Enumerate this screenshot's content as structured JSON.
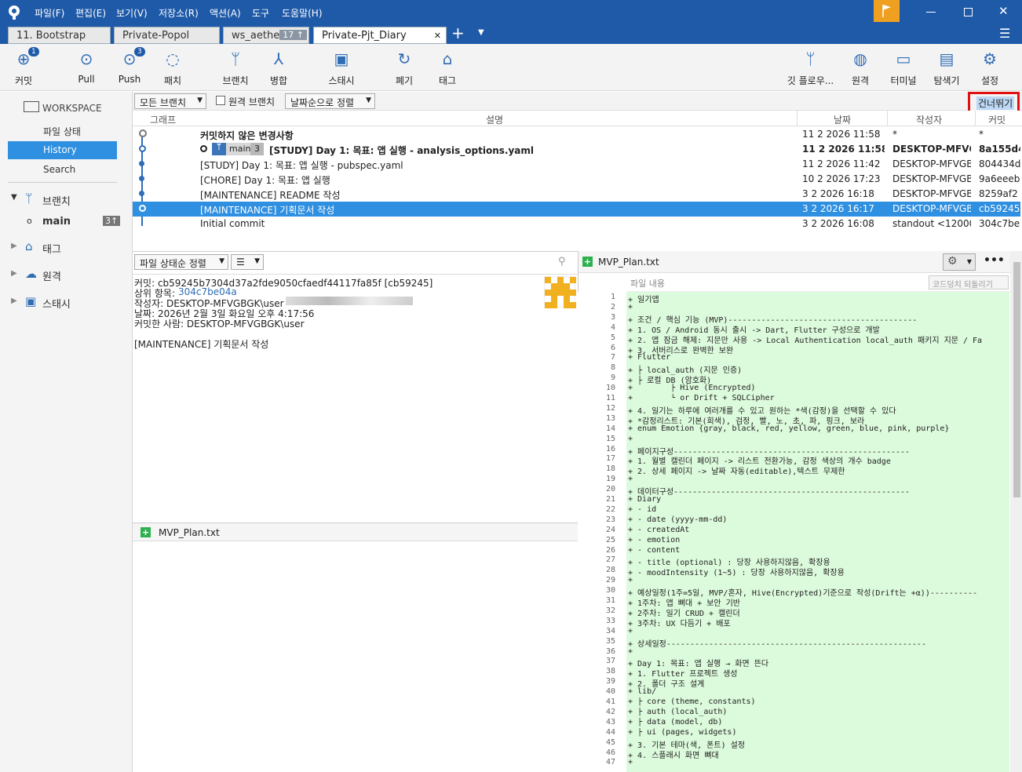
{
  "menu": [
    "파일(F)",
    "편집(E)",
    "보기(V)",
    "저장소(R)",
    "액션(A)",
    "도구",
    "도움말(H)"
  ],
  "tabs": [
    {
      "label": "11. Bootstrap"
    },
    {
      "label": "Private-Popol"
    },
    {
      "label": "ws_aether",
      "badge": "17 ↑"
    },
    {
      "label": "Private-Pjt_Diary",
      "close": "✕"
    }
  ],
  "tab_add": "+",
  "toolbar": {
    "commit": "커밋",
    "commit_badge": "1",
    "pull": "Pull",
    "push": "Push",
    "push_badge": "3",
    "fetch": "패치",
    "branch": "브랜치",
    "merge": "병합",
    "stash": "스태시",
    "discard": "폐기",
    "tag": "태그",
    "gitflow": "깃 플로우...",
    "remote": "원격",
    "terminal": "터미널",
    "explorer": "탐색기",
    "settings": "설정"
  },
  "sidebar": {
    "workspace": "WORKSPACE",
    "file_status": "파일 상태",
    "history": "History",
    "search": "Search",
    "branches": "브랜치",
    "main": "main",
    "main_badge": "3↑",
    "tags": "태그",
    "remotes": "원격",
    "stashes": "스태시"
  },
  "filterbar": {
    "branches": "모든 브랜치",
    "remote_branches": "원격 브랜치",
    "sort": "날짜순으로 정렬",
    "skip": "건너뛰기"
  },
  "columns": {
    "graph": "그래프",
    "desc": "설명",
    "date": "날짜",
    "author": "작성자",
    "commit": "커밋"
  },
  "commits": [
    {
      "desc": "커밋하지 않은 변경사항",
      "date": "11 2 2026 11:58",
      "author": "*",
      "hash": "*"
    },
    {
      "desc": "[STUDY] Day 1: 목표: 앱 실행 - analysis_options.yaml",
      "date": "11 2 2026 11:58",
      "author": "DESKTOP-MFVGE",
      "hash": "8a155d4",
      "branch": "main",
      "branch_count": "3"
    },
    {
      "desc": "[STUDY] Day 1: 목표: 앱 실행 - pubspec.yaml",
      "date": "11 2 2026 11:42",
      "author": "DESKTOP-MFVGB",
      "hash": "804434d"
    },
    {
      "desc": "[CHORE] Day 1: 목표: 앱 실행",
      "date": "10 2 2026 17:23",
      "author": "DESKTOP-MFVGB",
      "hash": "9a6eeeb"
    },
    {
      "desc": "[MAINTENANCE] README 작성",
      "date": "3 2 2026 16:18",
      "author": "DESKTOP-MFVGB",
      "hash": "8259af2"
    },
    {
      "desc": "[MAINTENANCE] 기획문서 작성",
      "date": "3 2 2026 16:17",
      "author": "DESKTOP-MFVGB",
      "hash": "cb59245"
    },
    {
      "desc": "Initial commit",
      "date": "3 2 2026 16:08",
      "author": "standout <12000",
      "hash": "304c7be"
    }
  ],
  "lower_left": {
    "sort": "파일 상태순 정렬",
    "list_icon": "☰",
    "commit_line": "커밋: cb59245b7304d37a2fde9050cfaedf44117fa85f [cb59245]",
    "parent_label": "상위 항목:",
    "parent_hash": "304c7be04a",
    "author_line": "작성자: DESKTOP-MFVGBGK\\user",
    "date_line": "날짜: 2026년 2월 3일 화요일 오후 4:17:56",
    "committer_line": "커밋한 사람: DESKTOP-MFVGBGK\\user",
    "message": "[MAINTENANCE] 기획문서 작성",
    "file": "MVP_Plan.txt"
  },
  "diff": {
    "file": "MVP_Plan.txt",
    "header": "파일 내용",
    "revert": "코드덩치 되돌리기",
    "lines": [
      "+ 일기앱",
      "+",
      "+ 조건 / 핵심 기능 (MVP)----------------------------------------",
      "+ 1. OS / Android 동시 출시 -> Dart, Flutter 구성으로 개발",
      "+ 2. 앱 잠금 해제: 지문만 사용 -> Local Authentication local_auth 패키지 지문 / Fa",
      "+ 3. 서버리스로 완벽한 보완",
      "+ Flutter",
      "+ ├ local_auth (지문 인증)",
      "+ ├ 로컬 DB (암호화)",
      "+        ├ Hive (Encrypted)",
      "+        └ or Drift + SQLCipher",
      "+ 4. 일기는 하루에 여러개를 수 있고 원하는 *색(감정)을 선택할 수 있다",
      "+ *감정리스트: 기본(회색), 검정, 빨, 노, 초, 파, 핑크, 보라",
      "+ enum Emotion {gray, black, red, yellow, green, blue, pink, purple}",
      "+",
      "+ 페이지구성--------------------------------------------------",
      "+ 1. 월별 캘린더 페이지 -> 리스트 전환가능, 감정 색상의 개수 badge",
      "+ 2. 상세 페이지 -> 날짜 자동(editable),텍스트 무제한",
      "+",
      "+ 데이터구성--------------------------------------------------",
      "+ Diary",
      "+ - id",
      "+ - date (yyyy-mm-dd)",
      "+ - createdAt",
      "+ - emotion",
      "+ - content",
      "+ - title (optional) : 당장 사용하지않음, 확장용",
      "+ - moodIntensity (1~5) : 당장 사용하지않음, 확장용",
      "+",
      "+ 예상일정(1주=5일, MVP/혼자, Hive(Encrypted)기준으로 작성(Drift는 +α))----------",
      "+ 1주차: 앱 뼈대 + 보안 기반",
      "+ 2주차: 일기 CRUD + 캘린더",
      "+ 3주차: UX 다듬기 + 배포",
      "+",
      "+ 상세일정-------------------------------------------------------",
      "+",
      "+ Day 1: 목표: 앱 실행 → 화면 뜬다",
      "+ 1. Flutter 프로젝트 생성",
      "+ 2. 폴더 구조 설계",
      "+ lib/",
      "+ ├ core (theme, constants)",
      "+ ├ auth (local_auth)",
      "+ ├ data (model, db)",
      "+ ├ ui (pages, widgets)",
      "+ 3. 기본 테마(색, 폰트) 설정",
      "+ 4. 스플래시 화면 뼈대",
      "+"
    ]
  }
}
